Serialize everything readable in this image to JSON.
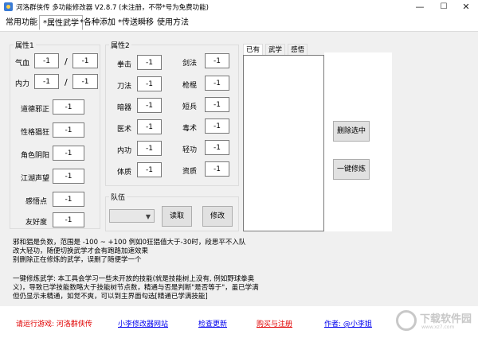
{
  "window": {
    "title": "河洛群侠传 多功能修改器 V2.8.7  (未注册，不带*号为免费功能)",
    "minimize": "—",
    "maximize": "☐",
    "close": "✕"
  },
  "tabs": [
    "常用功能",
    "*属性武学",
    "*各种添加",
    "*传送瞬移",
    "使用方法"
  ],
  "attr1": {
    "title": "属性1",
    "qixue_label": "气血",
    "qixue_value": "-1",
    "qixue_max": "-1",
    "neili_label": "内力",
    "neili_value": "-1",
    "neili_max": "-1",
    "slash": "/",
    "rows": [
      {
        "label": "道德邪正",
        "value": "-1"
      },
      {
        "label": "性格猖狂",
        "value": "-1"
      },
      {
        "label": "角色阴阳",
        "value": "-1"
      },
      {
        "label": "江湖声望",
        "value": "-1"
      },
      {
        "label": "感悟点",
        "value": "-1"
      },
      {
        "label": "友好度",
        "value": "-1"
      }
    ]
  },
  "attr2": {
    "title": "属性2",
    "left": [
      {
        "label": "拳击",
        "value": "-1"
      },
      {
        "label": "刀法",
        "value": "-1"
      },
      {
        "label": "暗器",
        "value": "-1"
      },
      {
        "label": "医术",
        "value": "-1"
      },
      {
        "label": "内功",
        "value": "-1"
      },
      {
        "label": "体质",
        "value": "-1"
      }
    ],
    "right": [
      {
        "label": "剑法",
        "value": "-1"
      },
      {
        "label": "枪棍",
        "value": "-1"
      },
      {
        "label": "短兵",
        "value": "-1"
      },
      {
        "label": "毒术",
        "value": "-1"
      },
      {
        "label": "轻功",
        "value": "-1"
      },
      {
        "label": "资质",
        "value": "-1"
      }
    ]
  },
  "team": {
    "title": "队伍",
    "select_value": "",
    "read_button": "读取",
    "modify_button": "修改"
  },
  "skills": {
    "tabs": [
      "已有",
      "武学",
      "感悟"
    ],
    "delete_button": "删除选中",
    "practice_button": "一键修炼"
  },
  "notes": {
    "line1": "邪和猖是负数，范围是 -100 ~ +100 例如0狂猖值大于-30时，段思平不入队",
    "line2": "改大轻功，随便切换武学才会有跑路加速效果",
    "line3": "别删除正在修炼的武学，误删了随便学一个",
    "line4": "一键修炼武学: 本工具会学习一些未开放的技能(就是技能树上没有, 例如野球拳奥",
    "line5": "义)，导致已学技能数略大于技能树节点数，精通与否是判断\"是否等于\"，虽已学满",
    "line6": "但仍显示未精通，如觉不爽，可以到主界面勾选[精通已学满技能]"
  },
  "footer": {
    "run_game": "请运行游戏: 河洛群侠传",
    "site": "小李修改器网站",
    "update": "检查更新",
    "buy": "购买与注册",
    "author": "作者: @小李姐"
  },
  "watermark": {
    "text": "下载软件园",
    "sub": "www.xz7.com"
  },
  "colors": {
    "background": "#f0f0f0",
    "accent_red": "#e00000",
    "link_blue": "#0000ee"
  }
}
